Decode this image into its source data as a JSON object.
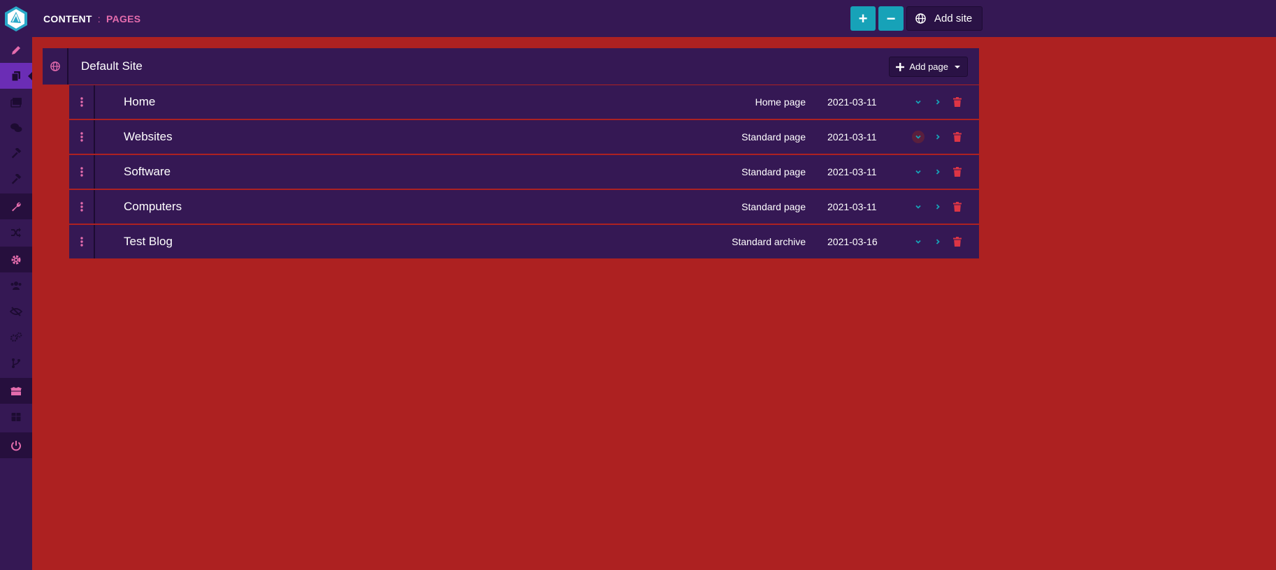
{
  "header": {
    "breadcrumb_root": "CONTENT",
    "breadcrumb_sep": ":",
    "breadcrumb_current": "PAGES",
    "expand_label": "+",
    "collapse_label": "−",
    "add_site_label": "Add site"
  },
  "sidebar": {
    "items": [
      {
        "icon": "pencil-icon"
      },
      {
        "icon": "pages-icon"
      },
      {
        "icon": "media-icon"
      },
      {
        "icon": "comments-icon"
      },
      {
        "icon": "hammer-icon"
      },
      {
        "icon": "hammer-icon"
      },
      {
        "icon": "wrench-icon"
      },
      {
        "icon": "shuffle-icon"
      },
      {
        "icon": "gear-icon"
      },
      {
        "icon": "users-icon"
      },
      {
        "icon": "eye-slash-icon"
      },
      {
        "icon": "gears-icon"
      },
      {
        "icon": "branch-icon"
      },
      {
        "icon": "box-open-icon"
      },
      {
        "icon": "box-icon"
      },
      {
        "icon": "power-icon"
      }
    ]
  },
  "site": {
    "title": "Default Site",
    "add_page_label": "Add page"
  },
  "pages": [
    {
      "title": "Home",
      "type": "Home page",
      "date": "2021-03-11"
    },
    {
      "title": "Websites",
      "type": "Standard page",
      "date": "2021-03-11"
    },
    {
      "title": "Software",
      "type": "Standard page",
      "date": "2021-03-11"
    },
    {
      "title": "Computers",
      "type": "Standard page",
      "date": "2021-03-11"
    },
    {
      "title": "Test Blog",
      "type": "Standard archive",
      "date": "2021-03-16"
    }
  ],
  "colors": {
    "background": "#ad2121",
    "panel": "#351854",
    "accent_pink": "#e46cad",
    "accent_teal": "#17a2b8",
    "delete_red": "#dc3545"
  }
}
